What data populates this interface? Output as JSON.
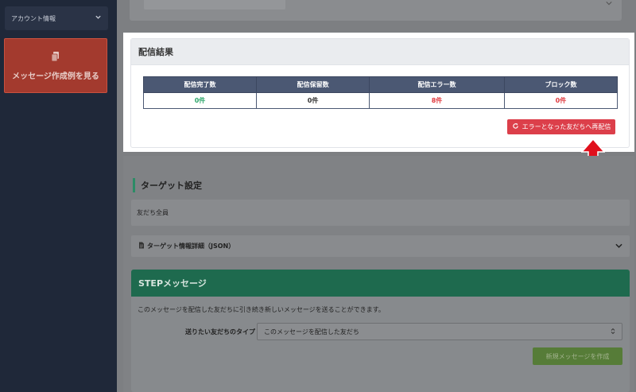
{
  "sidebar": {
    "account_label": "アカウント情報",
    "examples_label": "メッセージ作成例を見る"
  },
  "result": {
    "title": "配信結果",
    "columns": [
      "配信完了数",
      "配信保留数",
      "配信エラー数",
      "ブロック数"
    ],
    "values": [
      "0件",
      "0件",
      "8件",
      "0件"
    ],
    "resend_label": "エラーとなった友だちへ再配信"
  },
  "target": {
    "title": "ターゲット設定",
    "value": "友だち全員",
    "json_label": "ターゲット情報詳細（JSON）"
  },
  "step": {
    "title": "STEPメッセージ",
    "description": "このメッセージを配信した友だちに引き続き新しいメッセージを送ることができます。",
    "type_label": "送りたい友だちのタイプ",
    "type_value": "このメッセージを配信した友だち",
    "new_label": "新規メッセージを作成"
  },
  "colors": {
    "accent_red": "#dc3f4a",
    "header_navy": "#4b5873",
    "success_green": "#2da66b"
  }
}
